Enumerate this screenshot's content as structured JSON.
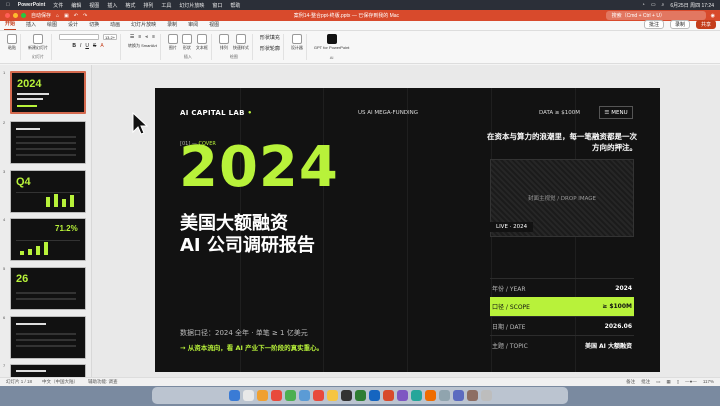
{
  "menubar": {
    "app": "PowerPoint",
    "items": [
      "文件",
      "编辑",
      "视图",
      "插入",
      "格式",
      "排列",
      "工具",
      "幻灯片放映",
      "窗口",
      "帮助"
    ],
    "clock": "6月25日 周四 17:24"
  },
  "window": {
    "autosave": "自动保存",
    "doc_title": "案例14-整合ppt-终版.pptx — 已保存到我的 Mac",
    "search_placeholder": "搜索（Cmd + Ctrl + U）"
  },
  "tabs": {
    "items": [
      "开始",
      "插入",
      "绘图",
      "设计",
      "切换",
      "动画",
      "幻灯片放映",
      "录制",
      "审阅",
      "视图"
    ],
    "active": 0,
    "comment": "批注",
    "record": "录制",
    "share": "共享"
  },
  "ribbon": {
    "groups": [
      {
        "label": "",
        "buttons": [
          "粘贴"
        ]
      },
      {
        "label": "幻灯片",
        "buttons": [
          "新建幻灯片"
        ]
      },
      {
        "label": "",
        "buttons": [
          "字体",
          "13.2+"
        ]
      },
      {
        "label": "",
        "buttons": [
          "转换为 SmartArt"
        ]
      },
      {
        "label": "插入",
        "buttons": [
          "图片",
          "形状",
          "文本框"
        ]
      },
      {
        "label": "绘图",
        "buttons": [
          "排列",
          "快速样式"
        ]
      },
      {
        "label": "",
        "buttons": [
          "形状填充",
          "形状轮廓"
        ]
      },
      {
        "label": "",
        "buttons": [
          "设计器"
        ]
      },
      {
        "label": "AI",
        "buttons": [
          "GPT for PowerPoint"
        ]
      }
    ]
  },
  "slide": {
    "brand": "AI CAPITAL LAB",
    "top_mid": "US AI MEGA-FUNDING",
    "top_data": "DATA ≥ $100M",
    "menu": "MENU",
    "cover_tag_prefix": "[01] — ",
    "cover_tag": "COVER",
    "year": "2024",
    "title_line1": "美国大额融资",
    "title_line2": "AI 公司调研报告",
    "caliber": "数据口径：2024 全年 · 单笔 ≥ 1 亿美元",
    "arrow_line": "→ 从资本流向，看 AI 产业下一阶段的真实重心。",
    "tagline": "在资本与算力的浪潮里，每一笔融资都是一次方向的押注。",
    "image_placeholder": "封面主视觉 / DROP IMAGE",
    "live": "LIVE · 2024",
    "info": [
      {
        "k": "年份 / YEAR",
        "v": "2024",
        "highlight": false
      },
      {
        "k": "口径 / SCOPE",
        "v": "≥ $100M",
        "highlight": true
      },
      {
        "k": "日期 / DATE",
        "v": "2026.06",
        "highlight": false
      },
      {
        "k": "主题 / TOPIC",
        "v": "美国 AI 大额融资",
        "highlight": false
      }
    ]
  },
  "thumbs": [
    {
      "num": "1",
      "big": "2024",
      "active": true
    },
    {
      "num": "2",
      "big": "",
      "active": false
    },
    {
      "num": "3",
      "big": "Q4",
      "active": false
    },
    {
      "num": "4",
      "big": "71.2%",
      "active": false
    },
    {
      "num": "5",
      "big": "26",
      "active": false
    },
    {
      "num": "6",
      "big": "",
      "active": false
    },
    {
      "num": "7",
      "big": "",
      "active": false
    }
  ],
  "status": {
    "slide_count": "幻灯片 1 / 18",
    "language": "中文（中国大陆）",
    "accessibility": "辅助功能: 调查",
    "notes": "备注",
    "comments": "批注",
    "zoom": "117%"
  },
  "colors": {
    "accent": "#b8f23a",
    "titlebar": "#d84a2c",
    "slide_bg": "#121212"
  }
}
